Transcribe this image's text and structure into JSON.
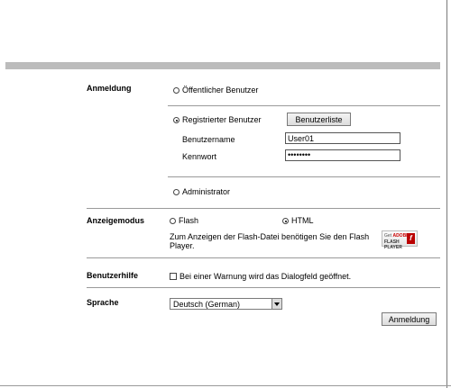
{
  "login": {
    "section_label": "Anmeldung",
    "public_user": "Öffentlicher Benutzer",
    "registered_user": "Registrierter Benutzer",
    "user_list_button": "Benutzerliste",
    "username_label": "Benutzername",
    "username_value": "User01",
    "password_label": "Kennwort",
    "password_value": "••••••••",
    "administrator": "Administrator",
    "selected": "registered"
  },
  "display_mode": {
    "section_label": "Anzeigemodus",
    "flash_option": "Flash",
    "html_option": "HTML",
    "selected": "html",
    "flash_note_line1": "Zum Anzeigen der Flash-Datei benötigen Sie den Flash",
    "flash_note_line2": "Player.",
    "badge_get": "Get",
    "badge_adobe": "ADOBE",
    "badge_player": "FLASH PLAYER",
    "badge_f": "f"
  },
  "user_help": {
    "section_label": "Benutzerhilfe",
    "warning_checkbox_label": "Bei einer Warnung wird das Dialogfeld geöffnet.",
    "checked": false
  },
  "language": {
    "section_label": "Sprache",
    "selected": "Deutsch (German)"
  },
  "submit_button": "Anmeldung"
}
